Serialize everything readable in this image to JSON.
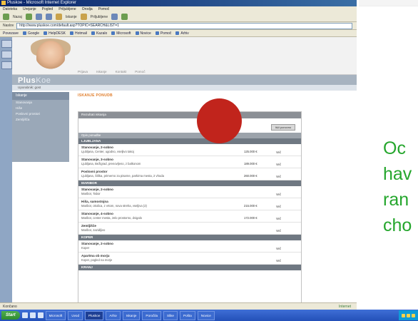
{
  "window": {
    "title": "Pluskoe - Microsoft Internet Explorer"
  },
  "menu": [
    "Datoteka",
    "Urejanje",
    "Pogled",
    "Priljubljene",
    "Orodja",
    "Pomoč"
  ],
  "toolbar": {
    "back_label": "Nazaj",
    "search_label": "Iskanje",
    "favorites_label": "Priljubljene"
  },
  "address": {
    "label": "Naslov",
    "url": "http://www.pluskoe.com/default.asp?TOPIC=SEARCH&LIST=1"
  },
  "links": {
    "label": "Povezave",
    "items": [
      "Google",
      "HelpDESK",
      "Hotmail",
      "Kazalo",
      "Microsoft",
      "Novice",
      "Pomoč",
      "Arhiv"
    ]
  },
  "site": {
    "topnav": [
      "Prijava",
      "Iskanje",
      "Kontakt",
      "Pomoč"
    ],
    "logo_main": "Plus",
    "logo_sub": "Koe",
    "user_line": "Uporabnik: gost",
    "sidebar_title": "Iskanje",
    "sidebar_items": [
      "Stanovanja",
      "Hiše",
      "Poslovni prostori",
      "Zemljišča"
    ],
    "page_title": "ISKANJE PONUDB",
    "panel_title": "Rezultati iskanja",
    "search_button": "Išči ponovno",
    "column_header": "Opis ponudbe",
    "sections": [
      {
        "name": "LJUBLJANA",
        "rows": [
          {
            "title": "Stanovanje, 2-sobno",
            "desc": "Ljubljana, Center, ugodno, vseljivo takoj",
            "price": "125.000 €",
            "link": "Več"
          },
          {
            "title": "Stanovanje, 3-sobno",
            "desc": "Ljubljana, Bežigrad, prenovljeno, z balkonom",
            "price": "189.000 €",
            "link": "Več"
          },
          {
            "title": "Poslovni prostor",
            "desc": "Ljubljana, Šiška, primerno za pisarne, parkirna mesta, 2 vhoda",
            "price": "260.000 €",
            "link": "Več"
          }
        ]
      },
      {
        "name": "MARIBOR",
        "rows": [
          {
            "title": "Stanovanje, 2-sobno",
            "desc": "Maribor, Tabor",
            "price": "",
            "link": "Več"
          },
          {
            "title": "Hiša, samostojna",
            "desc": "Maribor, okolica, z vrtom, nova streha, vseljiva (2)",
            "price": "215.000 €",
            "link": "Več"
          },
          {
            "title": "Stanovanje, 4-sobno",
            "desc": "Maribor, center mesta, zelo prostorno, dvigalo",
            "price": "172.000 €",
            "link": "Več"
          },
          {
            "title": "Zemljišče",
            "desc": "Maribor, zazidljivo",
            "price": "",
            "link": "Več"
          }
        ]
      },
      {
        "name": "KOPER",
        "rows": [
          {
            "title": "Stanovanje, 2-sobno",
            "desc": "Koper",
            "price": "",
            "link": "Več"
          },
          {
            "title": "Apartma ob morju",
            "desc": "Koper, pogled na morje",
            "price": "",
            "link": "Več"
          }
        ]
      },
      {
        "name": "KRANJ",
        "rows": []
      }
    ]
  },
  "statusbar": {
    "text": "Končano",
    "zone": "Internet"
  },
  "taskbar": {
    "start_label": "Start",
    "tasks": [
      "Microsoft",
      "Uvod",
      "Pluskoe",
      "Arhiv",
      "Iskanje",
      "Poročila",
      "Slike",
      "Pošta",
      "Novice"
    ]
  },
  "overlay_text": [
    "Oc",
    "hav",
    "ran",
    "cho"
  ],
  "colors": {
    "accent": "#e07b28",
    "marker": "#c1241c",
    "slide_text": "#25a62d"
  }
}
